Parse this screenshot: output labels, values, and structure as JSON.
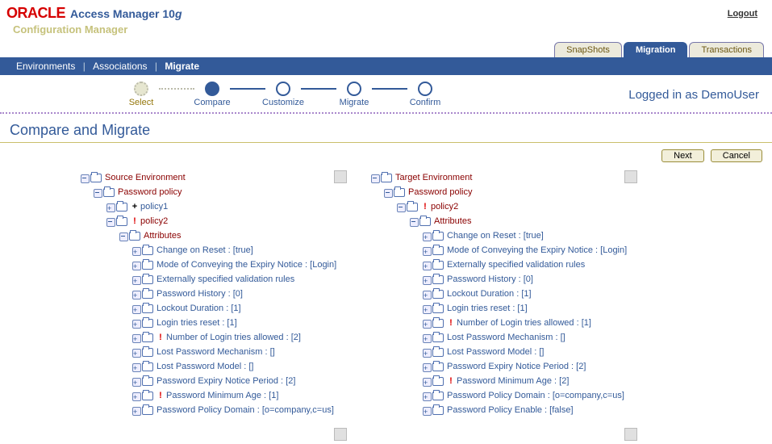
{
  "header": {
    "logo": "ORACLE",
    "product": "Access Manager 10",
    "product_suffix": "g",
    "logout": "Logout",
    "subtitle": "Configuration Manager"
  },
  "tabs": [
    {
      "label": "SnapShots",
      "active": false
    },
    {
      "label": "Migration",
      "active": true
    },
    {
      "label": "Transactions",
      "active": false
    }
  ],
  "nav": {
    "items": [
      "Environments",
      "Associations",
      "Migrate"
    ],
    "active_index": 2
  },
  "wizard": {
    "steps": [
      "Select",
      "Compare",
      "Customize",
      "Migrate",
      "Confirm"
    ],
    "current_index": 1
  },
  "logged_in": "Logged in as DemoUser",
  "page_title": "Compare and Migrate",
  "buttons": {
    "next": "Next",
    "cancel": "Cancel"
  },
  "source_tree": {
    "root": "Source Environment",
    "policy_group": "Password policy",
    "policies": [
      {
        "label": "policy1",
        "mark": "add",
        "expanded": false
      },
      {
        "label": "policy2",
        "mark": "bang",
        "expanded": true
      }
    ],
    "attributes_label": "Attributes",
    "attrs": [
      {
        "label": "Change on Reset : [true]",
        "mark": ""
      },
      {
        "label": "Mode of Conveying the Expiry Notice : [Login]",
        "mark": ""
      },
      {
        "label": "Externally specified validation rules",
        "mark": ""
      },
      {
        "label": "Password History : [0]",
        "mark": ""
      },
      {
        "label": "Lockout Duration : [1]",
        "mark": ""
      },
      {
        "label": "Login tries reset : [1]",
        "mark": ""
      },
      {
        "label": "Number of Login tries allowed : [2]",
        "mark": "bang"
      },
      {
        "label": "Lost Password Mechanism : []",
        "mark": ""
      },
      {
        "label": "Lost Password Model : []",
        "mark": ""
      },
      {
        "label": "Password Expiry Notice Period : [2]",
        "mark": ""
      },
      {
        "label": "Password Minimum Age : [1]",
        "mark": "bang"
      },
      {
        "label": "Password Policy Domain : [o=company,c=us]",
        "mark": ""
      }
    ]
  },
  "target_tree": {
    "root": "Target Environment",
    "policy_group": "Password policy",
    "policies": [
      {
        "label": "policy2",
        "mark": "bang",
        "expanded": true
      }
    ],
    "attributes_label": "Attributes",
    "attrs": [
      {
        "label": "Change on Reset : [true]",
        "mark": ""
      },
      {
        "label": "Mode of Conveying the Expiry Notice : [Login]",
        "mark": ""
      },
      {
        "label": "Externally specified validation rules",
        "mark": ""
      },
      {
        "label": "Password History : [0]",
        "mark": ""
      },
      {
        "label": "Lockout Duration : [1]",
        "mark": ""
      },
      {
        "label": "Login tries reset : [1]",
        "mark": ""
      },
      {
        "label": "Number of Login tries allowed : [1]",
        "mark": "bang"
      },
      {
        "label": "Lost Password Mechanism : []",
        "mark": ""
      },
      {
        "label": "Lost Password Model : []",
        "mark": ""
      },
      {
        "label": "Password Expiry Notice Period : [2]",
        "mark": ""
      },
      {
        "label": "Password Minimum Age : [2]",
        "mark": "bang"
      },
      {
        "label": "Password Policy Domain : [o=company,c=us]",
        "mark": ""
      },
      {
        "label": "Password Policy Enable : [false]",
        "mark": ""
      }
    ]
  }
}
